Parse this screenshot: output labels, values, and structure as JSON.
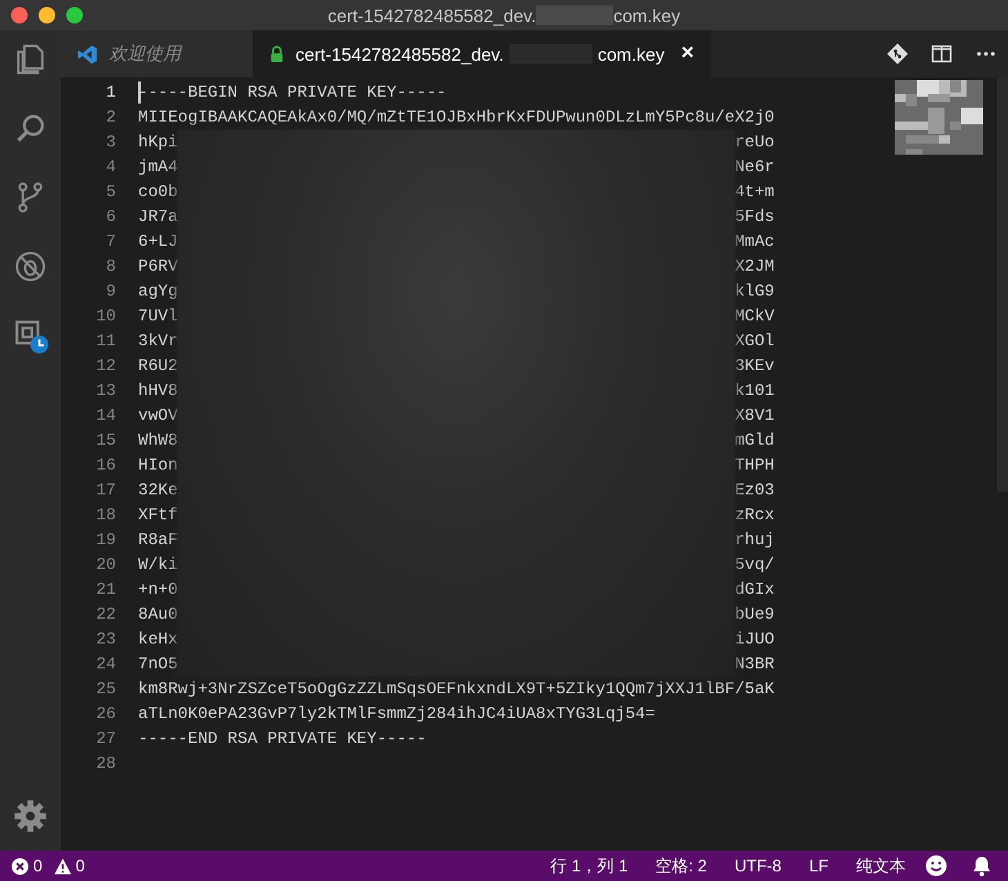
{
  "window": {
    "title_start": "cert-1542782485582_dev.",
    "title_end": "com.key"
  },
  "tabs": [
    {
      "kind": "welcome",
      "label": "欢迎使用",
      "selected": false
    },
    {
      "kind": "file",
      "label_start": "cert-1542782485582_dev.",
      "label_end": "com.key",
      "close": "×",
      "selected": true
    }
  ],
  "editor": {
    "lines": [
      {
        "number": "1",
        "current": true,
        "text": "-----BEGIN RSA PRIVATE KEY-----"
      },
      {
        "number": "2",
        "current": false,
        "text": "MIIEogIBAAKCAQEAkAx0/MQ/mZtTE1OJBxHbrKxFDUPwun0DLzLmY5Pc8u/eX2j0"
      },
      {
        "number": "3",
        "current": false,
        "start": "hKpi",
        "end": "reUo"
      },
      {
        "number": "4",
        "current": false,
        "start": "jmA4",
        "end": "Ne6r"
      },
      {
        "number": "5",
        "current": false,
        "start": "co0b",
        "end": "4t+m"
      },
      {
        "number": "6",
        "current": false,
        "start": "JR7a",
        "end": "5Fds"
      },
      {
        "number": "7",
        "current": false,
        "start": "6+LJ",
        "end": "MmAc"
      },
      {
        "number": "8",
        "current": false,
        "start": "P6RV",
        "end": "X2JM"
      },
      {
        "number": "9",
        "current": false,
        "start": "agYg",
        "end": "klG9"
      },
      {
        "number": "10",
        "current": false,
        "start": "7UVl",
        "end": "MCkV"
      },
      {
        "number": "11",
        "current": false,
        "start": "3kVr",
        "end": "XGOl"
      },
      {
        "number": "12",
        "current": false,
        "start": "R6U2",
        "end": "3KEv"
      },
      {
        "number": "13",
        "current": false,
        "start": "hHV8",
        "end": "k101"
      },
      {
        "number": "14",
        "current": false,
        "start": "vwOV",
        "end": "X8V1"
      },
      {
        "number": "15",
        "current": false,
        "start": "WhW8",
        "end": "mGld"
      },
      {
        "number": "16",
        "current": false,
        "start": "HIon",
        "end": "THPH"
      },
      {
        "number": "17",
        "current": false,
        "start": "32Ke",
        "end": "Ez03"
      },
      {
        "number": "18",
        "current": false,
        "start": "XFtf",
        "end": "zRcx"
      },
      {
        "number": "19",
        "current": false,
        "start": "R8aF",
        "end": "rhuj"
      },
      {
        "number": "20",
        "current": false,
        "start": "W/ki",
        "end": "5vq/"
      },
      {
        "number": "21",
        "current": false,
        "start": "+n+0",
        "end": "dGIx"
      },
      {
        "number": "22",
        "current": false,
        "start": "8Au0",
        "end": "bUe9"
      },
      {
        "number": "23",
        "current": false,
        "start": "keHx",
        "end": "iJUO"
      },
      {
        "number": "24",
        "current": false,
        "start": "7nO5",
        "end": "N3BR"
      },
      {
        "number": "25",
        "current": false,
        "text": "km8Rwj+3NrZSZceT5oOgGzZZLmSqsOEFnkxndLX9T+5ZIky1QQm7jXXJ1lBF/5aK"
      },
      {
        "number": "26",
        "current": false,
        "text": "aTLn0K0ePA23GvP7ly2kTMlFsmmZj284ihJC4iUA8xTYG3Lqj54="
      },
      {
        "number": "27",
        "current": false,
        "text": "-----END RSA PRIVATE KEY-----"
      },
      {
        "number": "28",
        "current": false
      }
    ]
  },
  "status_bar": {
    "errors": "0",
    "warnings": "0",
    "items": [
      "行 1，列 1",
      "空格: 2",
      "UTF-8",
      "LF",
      "纯文本"
    ]
  }
}
